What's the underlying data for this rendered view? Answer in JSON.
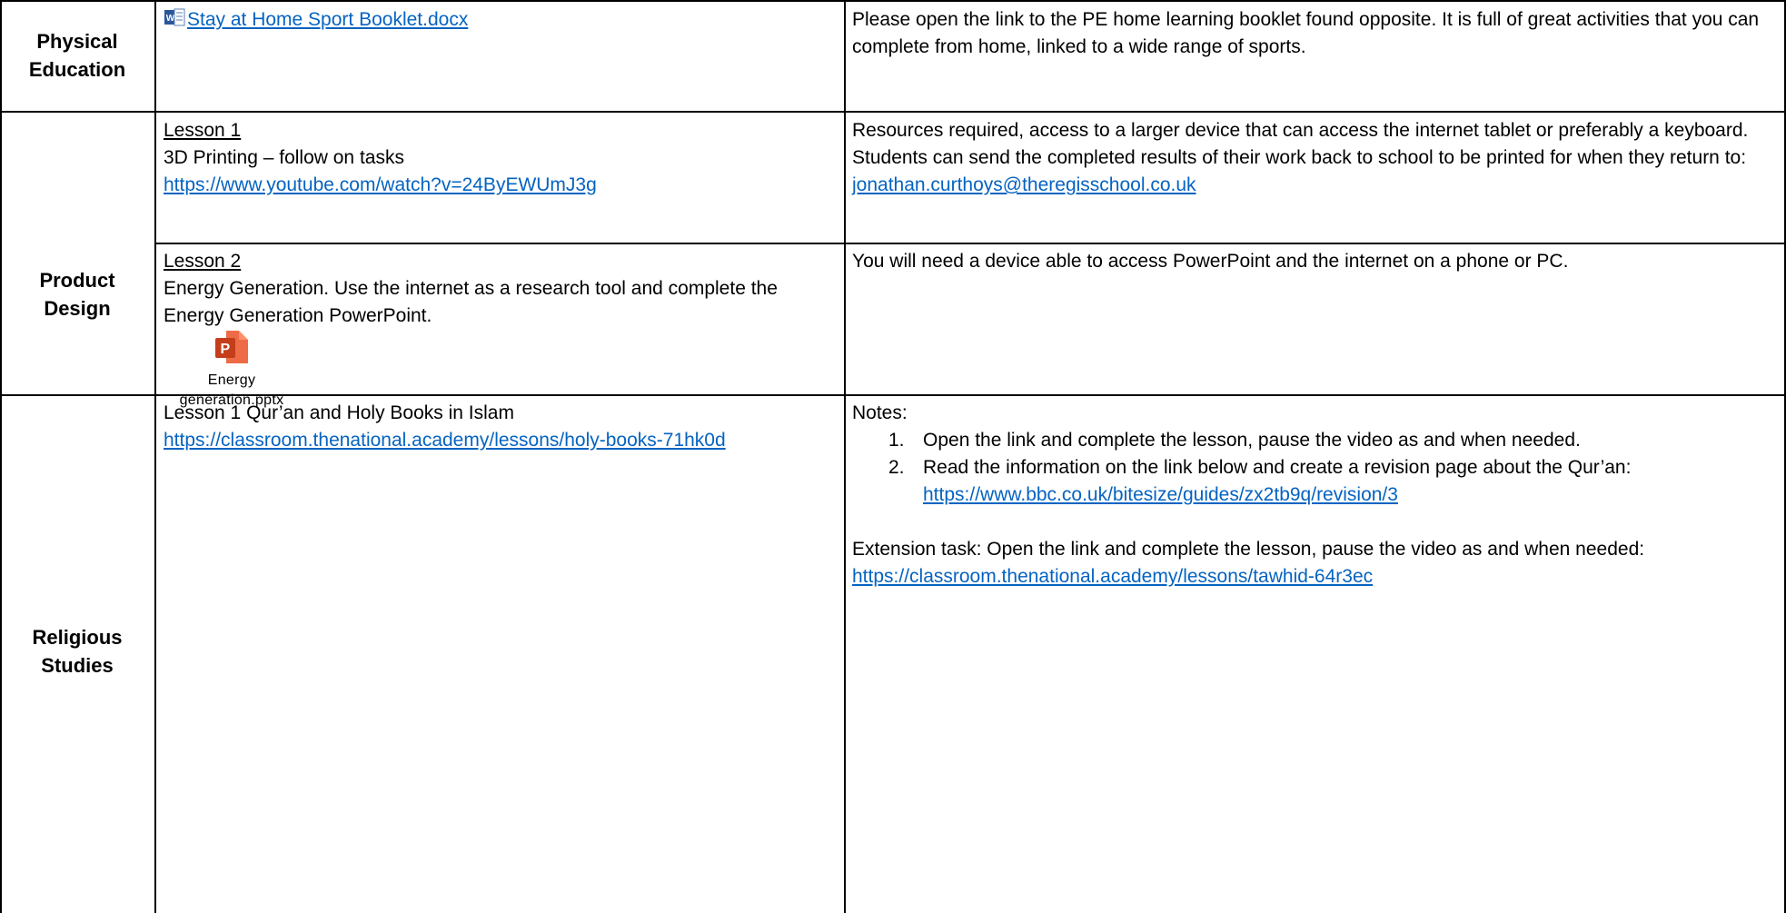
{
  "rows": {
    "pe": {
      "subject": [
        "Physical",
        "Education"
      ],
      "link": "Stay at Home Sport Booklet.docx",
      "notes": "Please open the link to the PE home learning booklet found opposite. It is full of great activities that you can complete from home, linked to a wide range of sports."
    },
    "pd": {
      "subject": [
        "Product",
        "Design"
      ],
      "lesson1": {
        "heading": "Lesson 1",
        "text": "3D Printing – follow on tasks",
        "link": "https://www.youtube.com/watch?v=24ByEWUmJ3g",
        "notes_prefix": "Resources required, access to a larger device that can access the internet tablet or preferably a keyboard. Students can send the completed results of their work back to school to be printed for when they return to: ",
        "email": "jonathan.curthoys@theregisschool.co.uk"
      },
      "lesson2": {
        "heading": "Lesson 2",
        "text": "Energy Generation. Use the internet as a research tool and  complete the Energy Generation PowerPoint.",
        "attachment": [
          "Energy",
          "generation.pptx"
        ],
        "notes": "You will need a device able to access PowerPoint and the internet on a phone or PC."
      }
    },
    "rs": {
      "subject": [
        "Religious",
        "Studies"
      ],
      "lesson": "Lesson 1 Qur’an and Holy Books in Islam",
      "link": "https://classroom.thenational.academy/lessons/holy-books-71hk0d",
      "notes_heading": "Notes:",
      "items": [
        {
          "num": "1.",
          "text": "Open the link and complete the lesson, pause the video as and when needed."
        },
        {
          "num": "2.",
          "text": "Read the information on the link below and create a revision page about the Qur’an:",
          "link": "https://www.bbc.co.uk/bitesize/guides/zx2tb9q/revision/3"
        }
      ],
      "extension": "Extension task: Open the link and complete the lesson, pause the video as and when needed:",
      "extension_link": "https://classroom.thenational.academy/lessons/tawhid-64r3ec"
    }
  },
  "colors": {
    "link": "#0563c1",
    "border": "#000000"
  }
}
